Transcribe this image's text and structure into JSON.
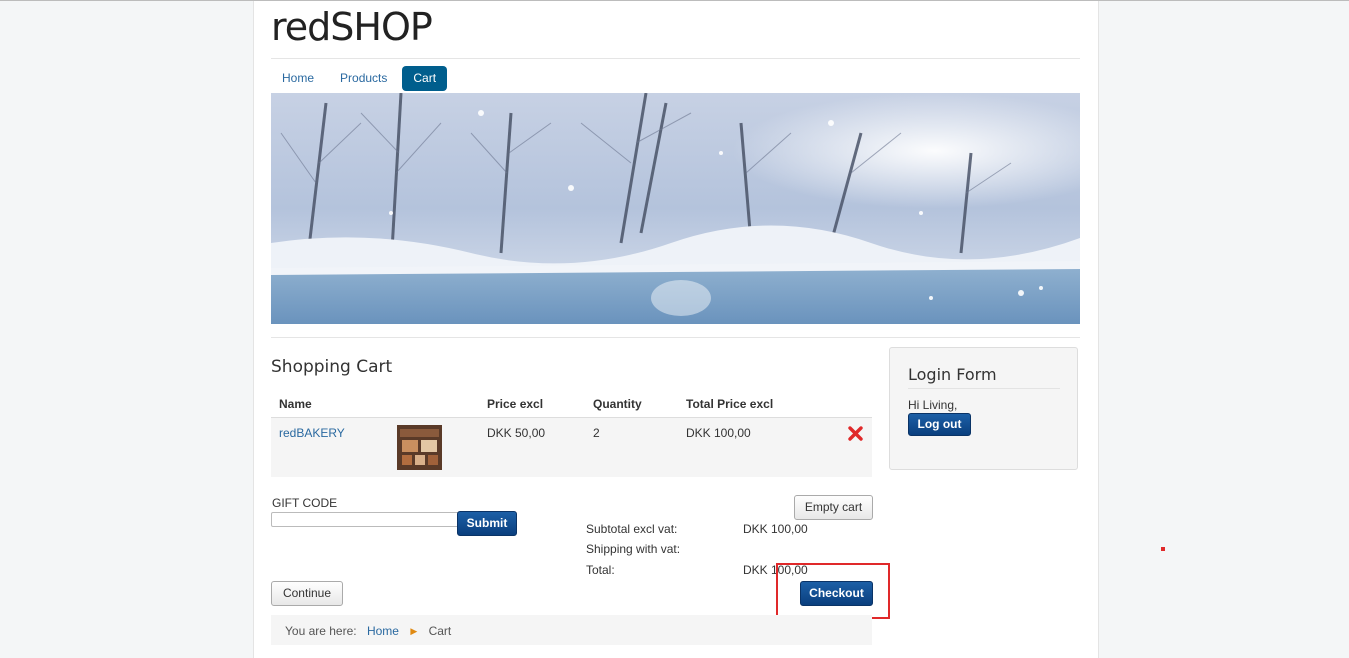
{
  "site": {
    "title": "redSHOP"
  },
  "nav": {
    "items": [
      {
        "label": "Home"
      },
      {
        "label": "Products"
      },
      {
        "label": "Cart"
      }
    ]
  },
  "cart": {
    "title": "Shopping Cart",
    "columns": [
      "Name",
      "",
      "Price excl",
      "Quantity",
      "Total Price excl",
      ""
    ],
    "rows": [
      {
        "name": "redBAKERY",
        "price": "DKK 50,00",
        "quantity": "2",
        "total": "DKK 100,00"
      }
    ],
    "gift_code_label": "GIFT CODE",
    "gift_code_value": "",
    "submit_label": "Submit",
    "empty_label": "Empty cart",
    "continue_label": "Continue",
    "checkout_label": "Checkout",
    "totals": {
      "subtotal_label": "Subtotal excl vat:",
      "subtotal_value": "DKK 100,00",
      "shipping_label": "Shipping with vat:",
      "shipping_value": "",
      "total_label": "Total:",
      "total_value": "DKK 100,00"
    }
  },
  "breadcrumb": {
    "prefix": "You are here:",
    "home": "Home",
    "current": "Cart"
  },
  "login": {
    "title": "Login Form",
    "greeting": "Hi Living,",
    "logout_label": "Log out"
  },
  "colors": {
    "accent": "#005e8d",
    "link": "#2a69a0",
    "danger": "#e0292a",
    "button_blue": "#0a3f7e"
  },
  "icons": {
    "delete": "delete-x-icon",
    "breadcrumb_sep": "triangle-right-icon"
  }
}
